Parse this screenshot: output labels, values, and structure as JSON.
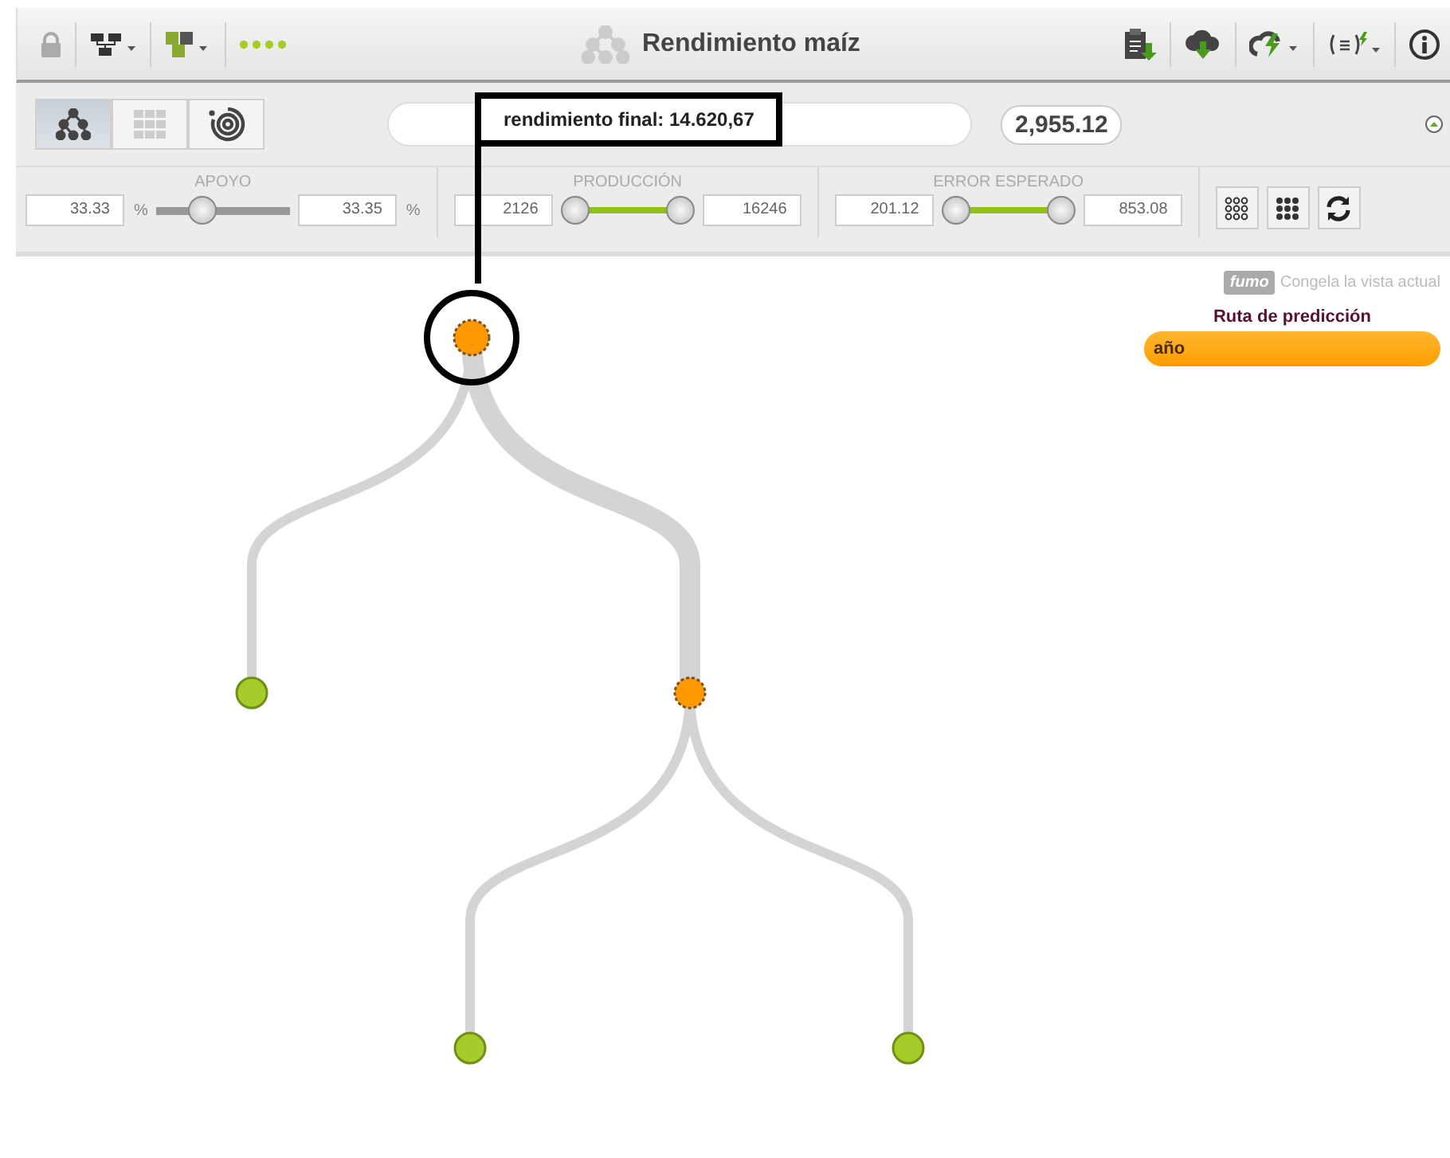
{
  "toolbar": {
    "title": "Rendimiento maíz"
  },
  "views": [
    {
      "kind": "tree",
      "selected": true
    },
    {
      "kind": "grid",
      "selected": false
    },
    {
      "kind": "sunburst",
      "selected": false
    }
  ],
  "prediction": {
    "value": "2,955.12"
  },
  "filters": [
    {
      "label": "APOYO",
      "min": "33.33",
      "max": "33.35",
      "unit": "%",
      "thumbs": [
        {
          "level": 0.3
        }
      ]
    },
    {
      "label": "PRODUCCIÓN",
      "min": "2126",
      "max": "16246",
      "thumbs": [
        {
          "level": 0
        },
        {
          "level": 1
        }
      ]
    },
    {
      "label": "ERROR ESPERADO",
      "min": "201.12",
      "max": "853.08",
      "thumbs": [
        {
          "level": 0
        },
        {
          "level": 1
        }
      ]
    }
  ],
  "freeze": {
    "badge": "fumo",
    "text": "Congela la vista actual"
  },
  "path": {
    "title": "Ruta de predicción",
    "items": [
      {
        "label": "año"
      }
    ]
  },
  "tree": {
    "kind": "split",
    "highlighted": true,
    "children": [
      {
        "kind": "leaf"
      },
      {
        "kind": "split",
        "children": [
          {
            "kind": "leaf"
          },
          {
            "kind": "leaf"
          }
        ]
      }
    ]
  },
  "annotation": {
    "text": "rendimiento final: 14.620,67"
  }
}
